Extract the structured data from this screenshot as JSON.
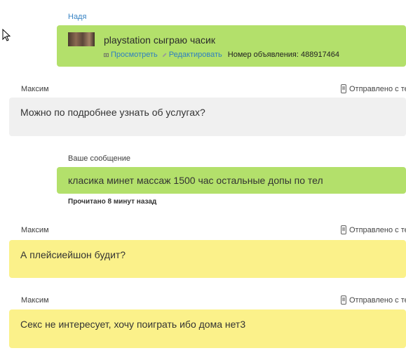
{
  "messages": [
    {
      "type": "ad",
      "sender": "Надя",
      "title": "playstation сыграю часик",
      "view_label": "Просмотреть",
      "edit_label": "Редактировать",
      "ad_number_label": "Номер объявления: 488917464"
    },
    {
      "type": "incoming",
      "sender": "Максим",
      "status": "Отправлено с тел",
      "text": "Можно по подробнее узнать об услугах?",
      "color": "#f0f0f0"
    },
    {
      "type": "outgoing",
      "sender": "Ваше сообщение",
      "text": "класика минет массаж 1500 час остальные допы по тел",
      "read_status": "Прочитано 8 минут назад",
      "color": "#b3e06b"
    },
    {
      "type": "incoming",
      "sender": "Максим",
      "status": "Отправлено с тел",
      "text": "А плейсиейшон будит?",
      "color": "#fbf18a"
    },
    {
      "type": "incoming",
      "sender": "Максим",
      "status": "Отправлено с тел",
      "text": "Секс не интересует, хочу поиграть ибо дома нет3",
      "color": "#fbf18a"
    }
  ],
  "icons": {
    "cursor": "mouse-pointer-icon",
    "phone": "mobile-phone-icon",
    "view": "eye-icon",
    "edit": "pencil-icon"
  }
}
